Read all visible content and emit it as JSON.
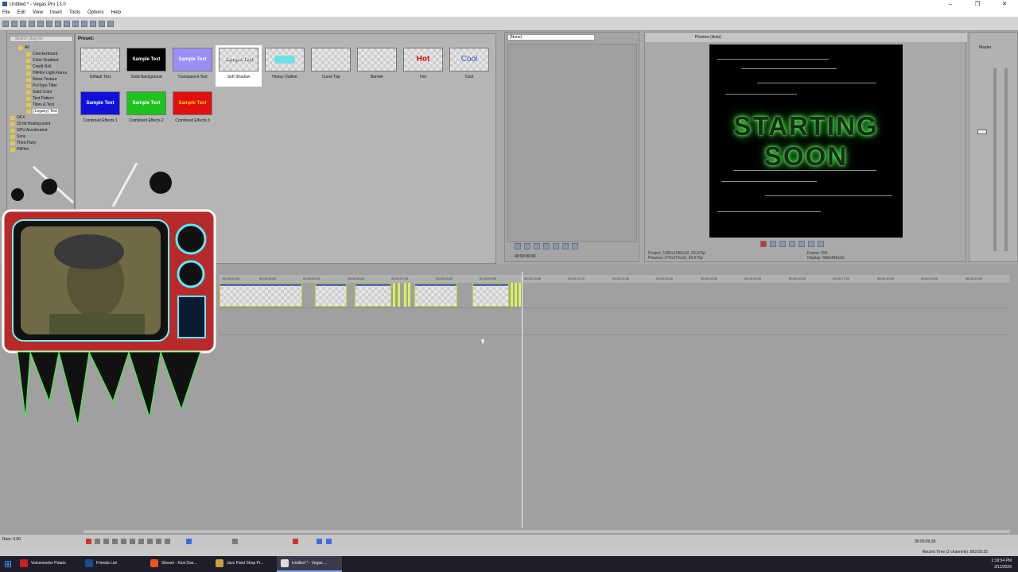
{
  "window": {
    "title": "Untitled * - Vegas Pro 13.0",
    "controls": [
      "–",
      "❐",
      "✕"
    ]
  },
  "menu": [
    "File",
    "Edit",
    "View",
    "Insert",
    "Tools",
    "Options",
    "Help"
  ],
  "tree": {
    "search_placeholder": "Search plug-ins",
    "items": [
      "All",
      "Checkerboard",
      "Color Gradient",
      "Credit Roll",
      "HitFilm Light Flares",
      "Noise Texture",
      "ProType Titler",
      "Solid Color",
      "Test Pattern",
      "Titles & Text",
      "(Legacy) Text",
      "OFX",
      "32-bit floating point",
      "GPU Accelerated",
      "Sony",
      "Third Party",
      "HitFilm"
    ]
  },
  "presets": {
    "label": "Preset:",
    "items": [
      {
        "name": "Default Text",
        "text": "Sample Text"
      },
      {
        "name": "Solid Background",
        "text": "Sample Text"
      },
      {
        "name": "Transparent Text",
        "text": "Sample Text"
      },
      {
        "name": "Soft Shadow",
        "text": "Sample Text"
      },
      {
        "name": "Heavy Outline",
        "text": ""
      },
      {
        "name": "Curve Top",
        "text": ""
      },
      {
        "name": "Banner",
        "text": ""
      },
      {
        "name": "Hot",
        "text": "Hot"
      },
      {
        "name": "Cool",
        "text": "Cool"
      },
      {
        "name": "Combined Effects 1",
        "text": "Sample Text"
      },
      {
        "name": "Combined Effects 2",
        "text": "Sample Text"
      },
      {
        "name": "Combined Effects 3",
        "text": "Sample Text"
      }
    ]
  },
  "trimmer": {
    "selector": "(None)",
    "timecode": "00:00:00;00"
  },
  "preview": {
    "mode": "Preview (Auto)",
    "overlay": [
      "STARTING",
      "SOON"
    ],
    "project": "Project: 1080x1080x32, 29.970p",
    "preview_res": "Preview: 270x270x32, 29.970p",
    "frame": "Frame: 299",
    "display": "Display: 486x486x32"
  },
  "mixer": {
    "label": "Master"
  },
  "timeline": {
    "ticks": [
      "00:00:03;00",
      "00:00:04;00",
      "00:00:05;00",
      "00:00:06;00",
      "00:00:07;00",
      "00:00:08;00",
      "00:00:09;00",
      "00:00:10;00",
      "00:00:11;00",
      "00:00:12;00",
      "00:00:13;00",
      "00:00:14;00",
      "00:00:15;00",
      "00:00:16;00",
      "00:00:17;00",
      "00:00:18;00",
      "00:00:19;00",
      "00:00:20;00"
    ]
  },
  "transport": {
    "rate": "Rate: 0.00",
    "timecode": "00:00:09;28"
  },
  "status": {
    "record_time": "Record Time (2 channels): 893:55:25"
  },
  "taskbar": {
    "items": [
      "Voicemeeter Potato",
      "Friends List",
      "Stream - Kick Das...",
      "Jasc Paint Shop Pr...",
      "Untitled * - Vegas ..."
    ],
    "time": "1:19:54 PM",
    "date": "3/11/2026"
  }
}
